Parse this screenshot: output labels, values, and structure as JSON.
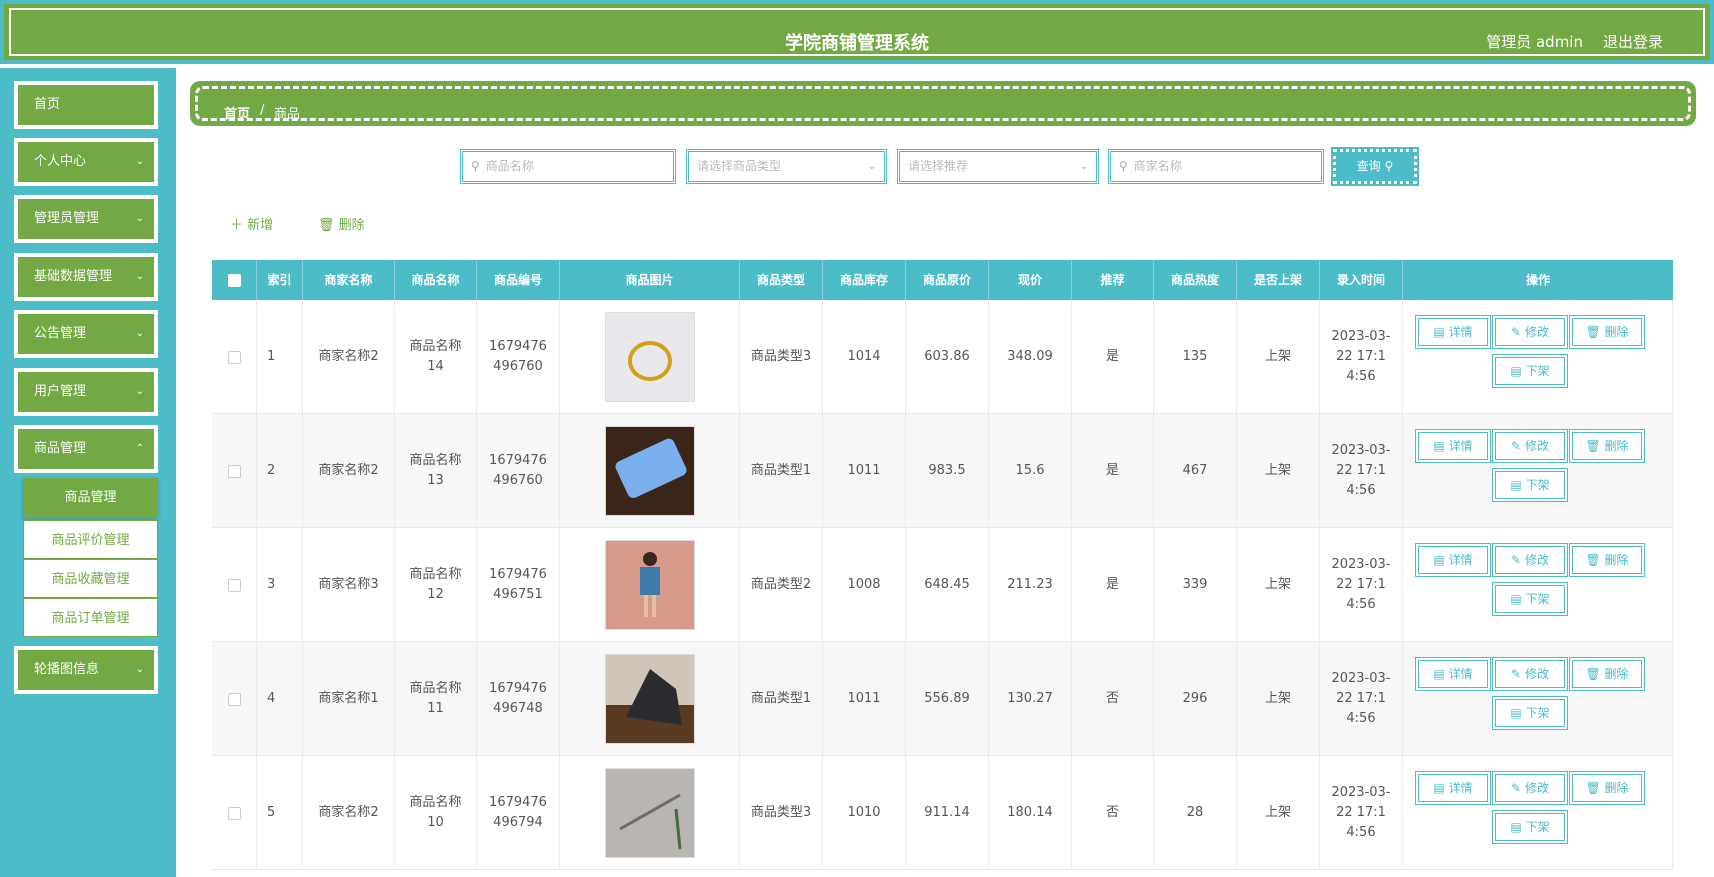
{
  "header": {
    "title": "学院商铺管理系统",
    "admin": "管理员 admin",
    "logout": "退出登录"
  },
  "sidebar": {
    "items": [
      {
        "label": "首页"
      },
      {
        "label": "个人中心"
      },
      {
        "label": "管理员管理"
      },
      {
        "label": "基础数据管理"
      },
      {
        "label": "公告管理"
      },
      {
        "label": "用户管理"
      },
      {
        "label": "商品管理"
      },
      {
        "label": "轮播图信息"
      }
    ],
    "sub": [
      {
        "label": "商品管理"
      },
      {
        "label": "商品评价管理"
      },
      {
        "label": "商品收藏管理"
      },
      {
        "label": "商品订单管理"
      }
    ]
  },
  "breadcrumb": {
    "home": "首页",
    "sep": "/",
    "current": "商品"
  },
  "search": {
    "name_placeholder": "商品名称",
    "type_placeholder": "请选择商品类型",
    "recommend_placeholder": "请选择推荐",
    "shop_placeholder": "商家名称",
    "query": "查询"
  },
  "toolbar": {
    "add": "新增",
    "delete": "删除"
  },
  "table": {
    "headers": [
      "索引",
      "商家名称",
      "商品名称",
      "商品编号",
      "商品图片",
      "商品类型",
      "商品库存",
      "商品原价",
      "现价",
      "推荐",
      "商品热度",
      "是否上架",
      "录入时间",
      "操作"
    ],
    "actions": {
      "detail": "详情",
      "edit": "修改",
      "delete": "删除",
      "off": "下架"
    },
    "rows": [
      {
        "idx": "1",
        "shop": "商家名称2",
        "name": "商品名称14",
        "code": "1679476496760",
        "type": "商品类型3",
        "stock": "1014",
        "orig": "603.86",
        "price": "348.09",
        "rec": "是",
        "hot": "135",
        "status": "上架",
        "time": "2023-03-22 17:14:56"
      },
      {
        "idx": "2",
        "shop": "商家名称2",
        "name": "商品名称13",
        "code": "1679476496760",
        "type": "商品类型1",
        "stock": "1011",
        "orig": "983.5",
        "price": "15.6",
        "rec": "是",
        "hot": "467",
        "status": "上架",
        "time": "2023-03-22 17:14:56"
      },
      {
        "idx": "3",
        "shop": "商家名称3",
        "name": "商品名称12",
        "code": "1679476496751",
        "type": "商品类型2",
        "stock": "1008",
        "orig": "648.45",
        "price": "211.23",
        "rec": "是",
        "hot": "339",
        "status": "上架",
        "time": "2023-03-22 17:14:56"
      },
      {
        "idx": "4",
        "shop": "商家名称1",
        "name": "商品名称11",
        "code": "1679476496748",
        "type": "商品类型1",
        "stock": "1011",
        "orig": "556.89",
        "price": "130.27",
        "rec": "否",
        "hot": "296",
        "status": "上架",
        "time": "2023-03-22 17:14:56"
      },
      {
        "idx": "5",
        "shop": "商家名称2",
        "name": "商品名称10",
        "code": "1679476496794",
        "type": "商品类型3",
        "stock": "1010",
        "orig": "911.14",
        "price": "180.14",
        "rec": "否",
        "hot": "28",
        "status": "上架",
        "time": "2023-03-22 17:14:56"
      }
    ]
  }
}
